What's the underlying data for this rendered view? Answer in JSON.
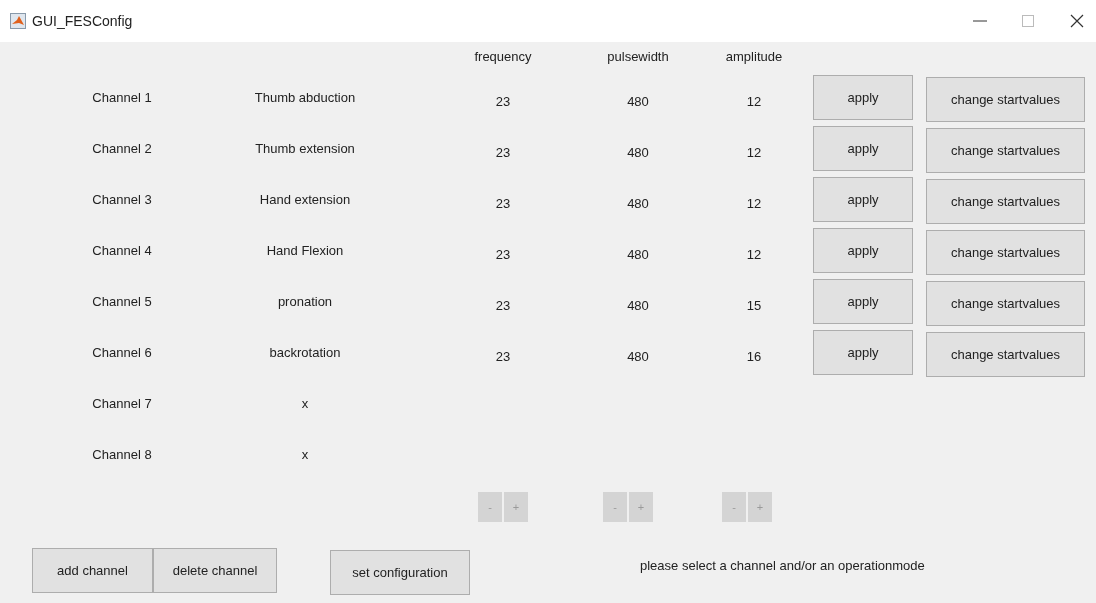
{
  "window": {
    "title": "GUI_FESConfig"
  },
  "columns": [
    "frequency",
    "pulsewidth",
    "amplitude"
  ],
  "channels": [
    {
      "name": "Channel 1",
      "muscle": "Thumb abduction",
      "frequency": "23",
      "pulsewidth": "480",
      "amplitude": "12",
      "apply": "apply",
      "change": "change startvalues"
    },
    {
      "name": "Channel 2",
      "muscle": "Thumb extension",
      "frequency": "23",
      "pulsewidth": "480",
      "amplitude": "12",
      "apply": "apply",
      "change": "change startvalues"
    },
    {
      "name": "Channel 3",
      "muscle": "Hand extension",
      "frequency": "23",
      "pulsewidth": "480",
      "amplitude": "12",
      "apply": "apply",
      "change": "change startvalues"
    },
    {
      "name": "Channel 4",
      "muscle": "Hand Flexion",
      "frequency": "23",
      "pulsewidth": "480",
      "amplitude": "12",
      "apply": "apply",
      "change": "change startvalues"
    },
    {
      "name": "Channel 5",
      "muscle": "pronation",
      "frequency": "23",
      "pulsewidth": "480",
      "amplitude": "15",
      "apply": "apply",
      "change": "change startvalues"
    },
    {
      "name": "Channel 6",
      "muscle": "backrotation",
      "frequency": "23",
      "pulsewidth": "480",
      "amplitude": "16",
      "apply": "apply",
      "change": "change startvalues"
    },
    {
      "name": "Channel 7",
      "muscle": "x"
    },
    {
      "name": "Channel 8",
      "muscle": "x"
    }
  ],
  "steppers": [
    {
      "minus": "-",
      "plus": "+",
      "disabled": true
    },
    {
      "minus": "-",
      "plus": "+",
      "disabled": true
    },
    {
      "minus": "-",
      "plus": "+",
      "disabled": true
    }
  ],
  "buttons": [
    "add channel",
    "delete channel",
    "set configuration"
  ],
  "message": "please select a channel and/or an operationmode"
}
